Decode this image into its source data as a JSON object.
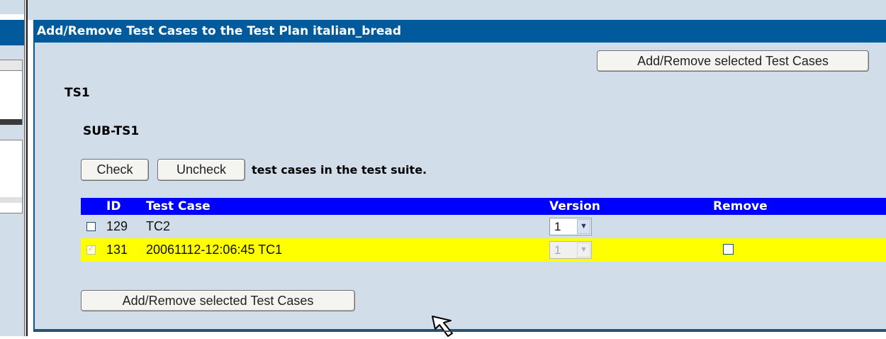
{
  "page": {
    "title": "Add/Remove Test Cases to the Test Plan italian_bread"
  },
  "actions": {
    "add_remove_label": "Add/Remove selected Test Cases",
    "check_label": "Check",
    "uncheck_label": "Uncheck",
    "check_hint": "test cases in the test suite."
  },
  "suite": {
    "name": "TS1",
    "sub_suite": "SUB-TS1"
  },
  "table": {
    "columns": {
      "id": "ID",
      "test_case": "Test Case",
      "version": "Version",
      "remove": "Remove"
    },
    "rows": [
      {
        "id": "129",
        "name": "TC2",
        "version": "1",
        "selected": false,
        "assigned": false
      },
      {
        "id": "131",
        "name": "20061112-12:06:45 TC1",
        "version": "1",
        "selected": true,
        "assigned": true
      }
    ]
  },
  "colors": {
    "title_bar": "#005a9c",
    "panel": "#d1dee9",
    "table_header": "#0000ff",
    "assigned_row": "#ffff00"
  },
  "icons": {
    "dropdown": "chevron-down-icon",
    "cursor": "mouse-pointer-icon"
  }
}
